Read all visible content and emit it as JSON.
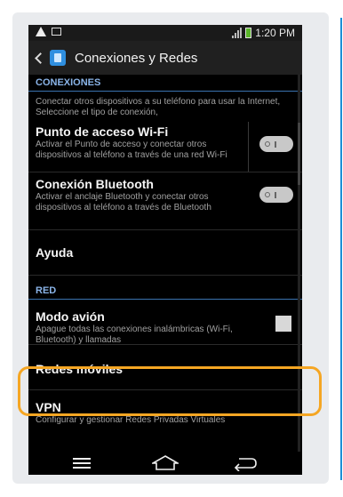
{
  "status_bar": {
    "time": "1:20 PM",
    "icons": [
      "warning-icon",
      "image-icon",
      "signal-icon",
      "battery-icon"
    ]
  },
  "action_bar": {
    "title": "Conexiones y Redes"
  },
  "sections": {
    "conexiones": {
      "header": "CONEXIONES",
      "description": "Conectar otros dispositivos a su teléfono para usar la Internet, Seleccione el tipo de conexión,",
      "items": [
        {
          "title": "Punto de acceso Wi-Fi",
          "subtitle": "Activar el Punto de acceso y conectar otros dispositivos al teléfono a través de una red Wi-Fi",
          "control": "toggle-off"
        },
        {
          "title": "Conexión Bluetooth",
          "subtitle": "Activar el anclaje Bluetooth y conectar otros dispositivos al teléfono a través de Bluetooth",
          "control": "toggle-off"
        },
        {
          "title": "Ayuda"
        }
      ]
    },
    "red": {
      "header": "RED",
      "items": [
        {
          "title": "Modo avión",
          "subtitle": "Apague todas las conexiones inalámbricas (Wi-Fi, Bluetooth) y llamadas",
          "control": "checkbox-unchecked"
        },
        {
          "title": "Redes móviles"
        },
        {
          "title": "VPN",
          "subtitle": "Configurar y gestionar Redes Privadas Virtuales"
        }
      ]
    }
  },
  "colors": {
    "section_header": "#8ab4e8",
    "highlight": "#f5a623",
    "accent_line": "#1a8fd6"
  }
}
